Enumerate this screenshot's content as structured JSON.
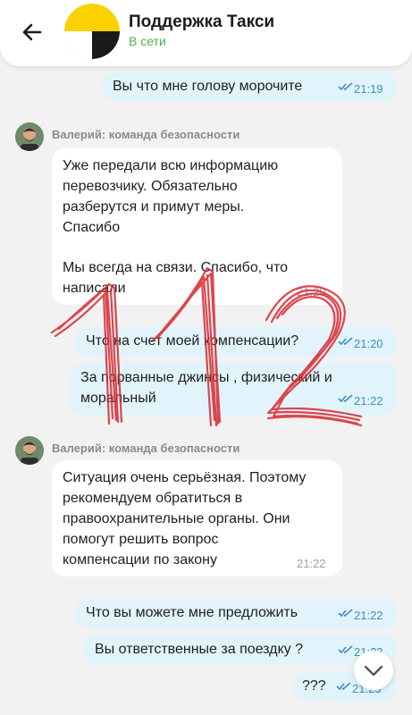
{
  "header": {
    "title": "Поддержка Такси",
    "status": "В сети",
    "back_icon": "arrow-left-icon",
    "logo_colors": [
      "#fbd200",
      "#1a1a1a",
      "#ffffff"
    ]
  },
  "colors": {
    "outgoing_bubble": "#e2f4fb",
    "incoming_bubble": "#ffffff",
    "background": "#f2f2f2",
    "online_status": "#4caf50",
    "read_ticks": "#3a8fc7",
    "watermark": "#d9272e"
  },
  "messages": [
    {
      "direction": "out",
      "text": "Вы что мне голову морочите",
      "time": "21:19"
    },
    {
      "direction": "in",
      "sender": "Валерий: команда безопасности",
      "lines": [
        "Уже передали всю информацию",
        "перевозчику. Обязательно",
        "разберутся и примут меры.",
        "Спасибо",
        "",
        "Мы всегда на связи. Спасибо, что",
        "написали"
      ],
      "time": "21:20"
    },
    {
      "direction": "out",
      "text": "Что на счет моей компенсации?",
      "time": "21:20"
    },
    {
      "direction": "out",
      "lines": [
        "За порванные джинсы  , физический и",
        "моральный"
      ],
      "time": "21:22"
    },
    {
      "direction": "in",
      "sender": "Валерий: команда безопасности",
      "lines": [
        "Ситуация очень серьёзная. Поэтому",
        "рекомендуем обратиться в",
        "правоохранительные органы. Они",
        "помогут решить вопрос",
        "компенсации по закону"
      ],
      "time": "21:22"
    },
    {
      "direction": "out",
      "text": "Что вы можете мне предложить",
      "time": "21:22"
    },
    {
      "direction": "out",
      "text": "Вы ответственные за поездку ?",
      "time": "21:23"
    },
    {
      "direction": "out",
      "text": "???",
      "time": "21:23"
    }
  ],
  "scroll_down_icon": "chevron-down-icon"
}
